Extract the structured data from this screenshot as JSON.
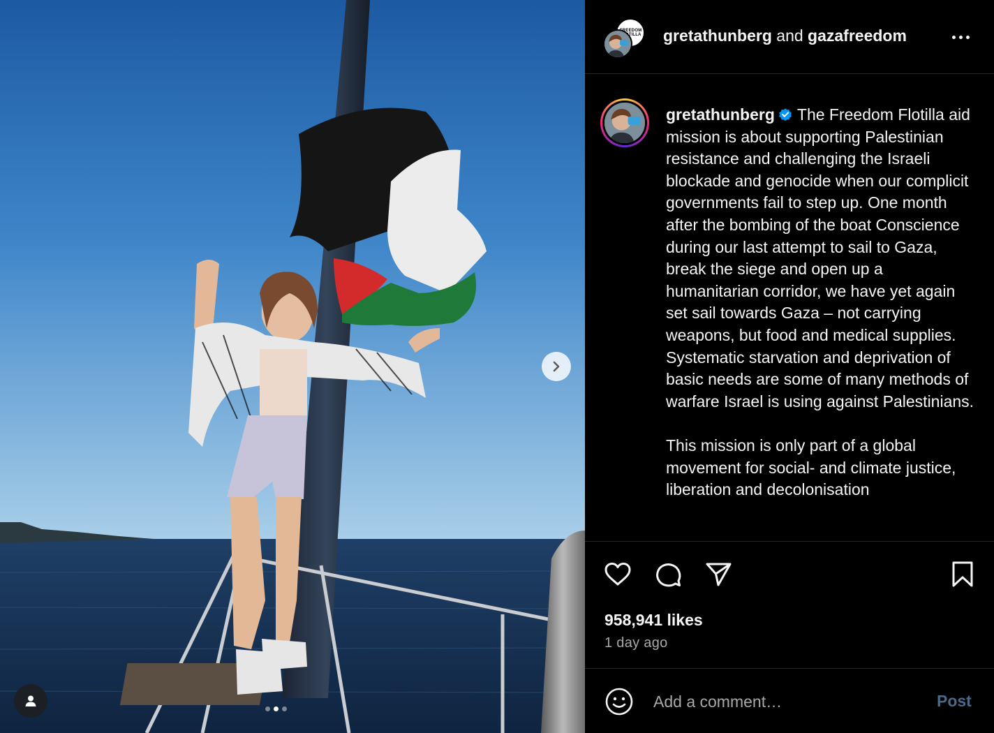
{
  "header": {
    "user1": "gretathunberg",
    "conjunction": "and",
    "user2": "gazafreedom",
    "collab_logo_text": "FREEDOM FLOTILLA"
  },
  "caption": {
    "username": "gretathunberg",
    "paragraph1": "The Freedom Flotilla aid mission is about supporting Palestinian resistance and challenging the Israeli blockade and genocide when our complicit governments fail to step up. One month after the bombing of the boat Conscience during our last attempt to sail to Gaza, break the siege and open up a humanitarian corridor, we have yet again set sail towards Gaza – not carrying weapons, but food and medical supplies. Systematic starvation and deprivation of basic needs are some of many methods of warfare Israel is using against Palestinians.",
    "paragraph2": "This mission is only part of a global movement for social- and climate justice, liberation and decolonisation"
  },
  "engagement": {
    "likes": "958,941 likes",
    "time": "1 day ago"
  },
  "comment": {
    "placeholder": "Add a comment…",
    "post_label": "Post"
  },
  "carousel": {
    "total": 3,
    "active_index": 1
  },
  "colors": {
    "background": "#000000",
    "text": "#f5f5f5",
    "secondary": "#a8a8a8",
    "divider": "#262626",
    "post_disabled": "#4a6a8a",
    "verified": "#0095f6"
  },
  "icons": {
    "like": "heart-icon",
    "comment": "speech-bubble-icon",
    "share": "paper-plane-icon",
    "save": "bookmark-icon",
    "emoji": "smiley-icon",
    "more": "ellipsis-icon",
    "next": "chevron-right-icon",
    "tags": "user-tag-icon"
  }
}
